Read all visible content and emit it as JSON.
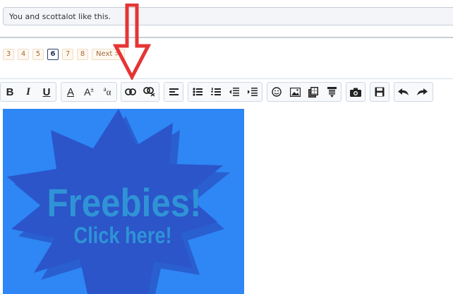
{
  "likes_text": "You and scottalot like this.",
  "pagination": {
    "pages": [
      "3",
      "4",
      "5",
      "6",
      "7",
      "8"
    ],
    "current": "6",
    "next_label": "Next >"
  },
  "toolbar": {
    "buttons": [
      {
        "name": "bold",
        "label": "B",
        "icon": "bold-icon"
      },
      {
        "name": "italic",
        "label": "I",
        "icon": "italic-icon"
      },
      {
        "name": "underline",
        "label": "U",
        "icon": "underline-icon"
      },
      {
        "name": "font-color",
        "label": "A",
        "icon": "font-color-icon"
      },
      {
        "name": "font-size",
        "label": "A",
        "icon": "font-size-icon"
      },
      {
        "name": "font-family",
        "label": "a",
        "icon": "font-family-icon"
      },
      {
        "name": "link",
        "icon": "link-icon"
      },
      {
        "name": "unlink",
        "icon": "unlink-icon"
      },
      {
        "name": "align",
        "icon": "align-left-icon"
      },
      {
        "name": "bullet-list",
        "icon": "bullet-list-icon"
      },
      {
        "name": "numbered-list",
        "icon": "numbered-list-icon"
      },
      {
        "name": "outdent",
        "icon": "outdent-icon"
      },
      {
        "name": "indent",
        "icon": "indent-icon"
      },
      {
        "name": "smilies",
        "icon": "smiley-icon"
      },
      {
        "name": "image",
        "icon": "image-icon"
      },
      {
        "name": "media",
        "icon": "media-icon"
      },
      {
        "name": "insert",
        "icon": "insert-icon"
      },
      {
        "name": "upload-image",
        "icon": "camera-icon"
      },
      {
        "name": "save-draft",
        "icon": "save-icon"
      },
      {
        "name": "undo",
        "icon": "undo-icon"
      },
      {
        "name": "redo",
        "icon": "redo-icon"
      }
    ]
  },
  "banner": {
    "title": "Freebies!",
    "subtitle": "Click here!",
    "background": "#2f86f5",
    "star_color": "#2b55c9",
    "text_color": "#2f93d6"
  },
  "annotation": {
    "arrow_color": "#e53535"
  }
}
